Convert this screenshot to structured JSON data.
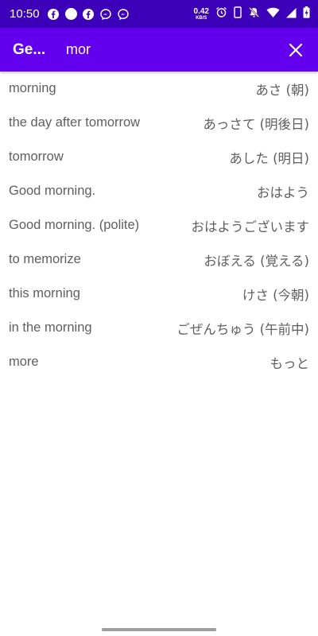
{
  "status_bar": {
    "time": "10:50",
    "net_speed_value": "0.42",
    "net_speed_unit": "KB/S",
    "notification_icons": [
      "facebook-icon",
      "circle-icon",
      "facebook-icon",
      "messenger-icon",
      "messenger-icon"
    ],
    "system_icons": [
      "alarm-icon",
      "phone-icon",
      "mute-icon",
      "wifi-icon",
      "signal-icon",
      "battery-icon"
    ]
  },
  "app_bar": {
    "title": "Ge...",
    "search_value": "mor",
    "close_icon": "close-icon"
  },
  "results": [
    {
      "english": "morning",
      "japanese": "あさ (朝)"
    },
    {
      "english": "the day after tomorrow",
      "japanese": "あっさて (明後日)"
    },
    {
      "english": "tomorrow",
      "japanese": "あした (明日)"
    },
    {
      "english": "Good morning.",
      "japanese": "おはよう"
    },
    {
      "english": "Good morning. (polite)",
      "japanese": "おはようございます"
    },
    {
      "english": "to memorize",
      "japanese": "おぼえる (覚える)"
    },
    {
      "english": "this morning",
      "japanese": "けさ (今朝)"
    },
    {
      "english": "in the morning",
      "japanese": "ごぜんちゅう (午前中)"
    },
    {
      "english": "more",
      "japanese": "もっと"
    }
  ],
  "colors": {
    "status_bar": "#3b00b8",
    "app_bar": "#6200ee",
    "text": "#5f5f5f"
  }
}
